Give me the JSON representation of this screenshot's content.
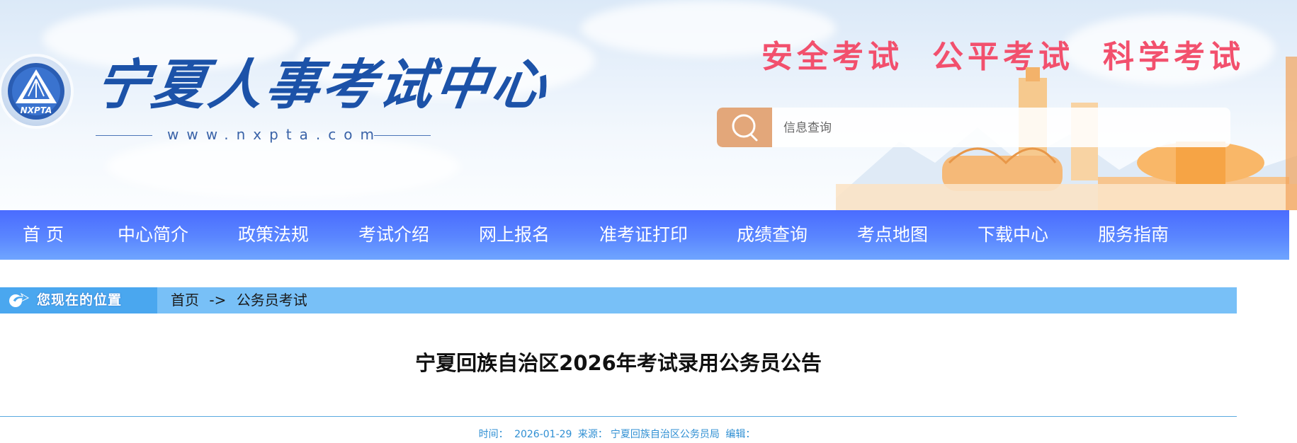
{
  "header": {
    "site_name": "宁夏人事考试中心",
    "site_url": "www.nxpta.com",
    "logo_text": "NXPTA",
    "slogans": [
      "安全考试",
      "公平考试",
      "科学考试"
    ],
    "search": {
      "placeholder": "信息查询",
      "value": ""
    }
  },
  "nav": {
    "items": [
      "首  页",
      "中心简介",
      "政策法规",
      "考试介绍",
      "网上报名",
      "准考证打印",
      "成绩查询",
      "考点地图",
      "下载中心",
      "服务指南"
    ]
  },
  "breadcrumb": {
    "label": "您现在的位置",
    "items": [
      "首页",
      "公务员考试"
    ],
    "separator": "->"
  },
  "article": {
    "title": "宁夏回族自治区2026年考试录用公务员公告",
    "meta": {
      "time_label": "时间：",
      "time": "2026-01-29",
      "source_label": "来源：",
      "source": "宁夏回族自治区公务员局",
      "editor_label": "编辑：",
      "editor": ""
    }
  },
  "colors": {
    "nav_bg": "#5a86ff",
    "slogan": "#f2506d",
    "brand_blue": "#1c52a8",
    "crumb_bar": "#78c0f7",
    "meta_text": "#2f8fd3",
    "search_btn": "#e3a77a"
  },
  "icons": {
    "search": "search-icon",
    "breadcrumb": "location-arrow-icon"
  }
}
